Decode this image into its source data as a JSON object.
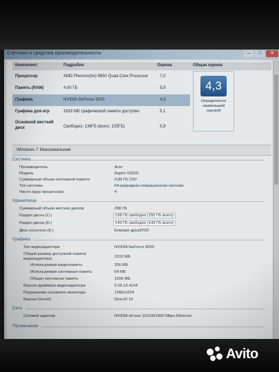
{
  "window": {
    "title": "Счётчики и средства производительности"
  },
  "rating_table": {
    "headers": [
      "Компонент",
      "Подробно",
      "Оценка",
      "Общая оценка"
    ],
    "rows": [
      {
        "component": "Процессор",
        "detail": "AMD Phenom(tm) 9650 Quad-Core Processor",
        "score": "7,0"
      },
      {
        "component": "Память (RAM)",
        "detail": "4,00 ГБ",
        "score": "5,9"
      },
      {
        "component": "Графика",
        "detail": "NVIDIA GeForce 9200",
        "score": "4,3"
      },
      {
        "component": "Графика для игр",
        "detail": "1919 МБ графической памяти доступно",
        "score": "5,1"
      },
      {
        "component": "Основной жесткий диск",
        "detail": "Свободно: 136ГБ (всего: 155ГБ)",
        "score": "5,9"
      }
    ],
    "overall_score": "4,3",
    "overall_caption": "Определяется наименьшей оценкой"
  },
  "edition": "Windows 7 Максимальная",
  "sections": [
    {
      "title": "Система",
      "rows": [
        {
          "label": "Производитель",
          "value": "Acer"
        },
        {
          "label": "Модель",
          "value": "Aspire X3200"
        },
        {
          "label": "Суммарный объем системной памяти",
          "value": "4,00 ГБ ОЗУ"
        },
        {
          "label": "Тип системы",
          "value": "64-разрядная операционная система"
        },
        {
          "label": "Число ядер процессора",
          "value": "4"
        }
      ]
    },
    {
      "title": "Хранилище",
      "rows": [
        {
          "label": "Суммарный объем жестких дисков",
          "value": "298 ГБ"
        },
        {
          "label": "Раздел диска (C:)",
          "value": "138 ГБ свободно (155 ГБ всего)"
        },
        {
          "label": "Раздел диска (D:)",
          "value": "140 ГБ свободно (143 ГБ всего)"
        },
        {
          "label": "Диск носителя (E:)",
          "value": "Компакт-диск/DVD"
        }
      ]
    },
    {
      "title": "Графика",
      "rows": [
        {
          "label": "Тип видеоадаптера",
          "value": "NVIDIA GeForce 9200"
        },
        {
          "label": "Общий размер доступной памяти видеоадаптера",
          "value": "1919 МБ"
        },
        {
          "label": "Используемая видеопамять",
          "value": "256 МБ"
        },
        {
          "label": "Используемая системная память",
          "value": "64 МБ"
        },
        {
          "label": "Общая системная память",
          "value": "1599 МБ"
        },
        {
          "label": "Версия драйвера видеоадаптера",
          "value": "9.18.13.4144"
        },
        {
          "label": "Разрешение основного монитора",
          "value": "1280x1024"
        },
        {
          "label": "Версия DirectX",
          "value": "DirectX 10"
        }
      ]
    },
    {
      "title": "Сеть",
      "rows": [
        {
          "label": "Сетевой адаптер",
          "value": "NVIDIA nForce 10/100/1000 Mbps Ethernet"
        }
      ]
    },
    {
      "title": "Примечания",
      "rows": []
    }
  ],
  "watermark": {
    "text": "Avito"
  }
}
